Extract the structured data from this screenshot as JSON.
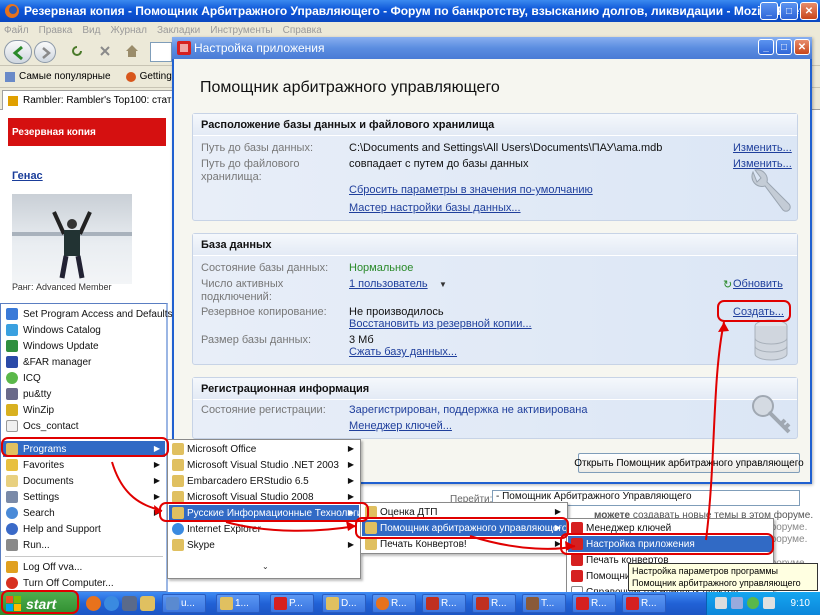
{
  "browser": {
    "title": "Резервная копия - Помощник Арбитражного Управляющего - Форум по банкротству, взысканию долгов, ликвидации - Mozilla Firefox",
    "menu": [
      "Файл",
      "Правка",
      "Вид",
      "Журнал",
      "Закладки",
      "Инструменты",
      "Справка"
    ],
    "bookmarks": [
      "Самые популярные",
      "Getting Starte"
    ],
    "tab": "Rambler: Rambler's Top100: статист..."
  },
  "web": {
    "header": "Резервная копия",
    "user": "Генас",
    "rank": "Ранг: Advanced Member"
  },
  "forum": {
    "goto_label": "Перейти:",
    "goto_value": "- Помощник Арбитражного Управляющего",
    "line1_bold": "можете",
    "line1": "создавать новые темы в этом форуме.",
    "frag1": "форуме.",
    "frag2": "форуме.",
    "frag3": "форуме."
  },
  "dialog": {
    "title": "Настройка приложения",
    "heading": "Помощник арбитражного управляющего",
    "storage": {
      "title": "Расположение базы данных и файлового хранилища",
      "db_path_label": "Путь до базы данных:",
      "db_path_value": "C:\\Documents and Settings\\All Users\\Documents\\ПАУ\\ama.mdb",
      "db_path_change": "Изменить...",
      "file_path_label": "Путь до файлового хранилища:",
      "file_path_value": "совпадает с путем до базы данных",
      "file_path_change": "Изменить...",
      "reset_link": "Сбросить параметры в значения по-умолчанию",
      "wizard_link": "Мастер настройки базы данных..."
    },
    "database": {
      "title": "База данных",
      "state_label": "Состояние базы данных:",
      "state_value": "Нормальное",
      "connections_label": "Число активных подключений:",
      "connections_value": "1 пользователь",
      "refresh": "Обновить",
      "backup_label": "Резервное копирование:",
      "backup_value": "Не производилось",
      "restore_link": "Восстановить из резервной копии...",
      "create_link": "Создать...",
      "size_label": "Размер базы данных:",
      "size_value": "3 Мб",
      "compress_link": "Сжать базу данных..."
    },
    "registration": {
      "title": "Регистрационная информация",
      "state_label": "Состояние регистрации:",
      "state_value": "Зарегистрирован, поддержка не активирована",
      "keys_link": "Менеджер ключей..."
    },
    "open_button": "Открыть Помощник арбитражного управляющего"
  },
  "start_menu": {
    "pinned": [
      "Set Program Access and Defaults",
      "Windows Catalog",
      "Windows Update",
      "&FAR manager",
      "ICQ",
      "pu&tty",
      "WinZip",
      "Ocs_contact"
    ],
    "items": [
      "Programs",
      "Favorites",
      "Documents",
      "Settings",
      "Search",
      "Help and Support",
      "Run..."
    ],
    "logoff": "Log Off vva...",
    "turnoff": "Turn Off Computer..."
  },
  "programs_menu": [
    "Microsoft Office",
    "Microsoft Visual Studio .NET 2003",
    "Embarcadero ERStudio 6.5",
    "Microsoft Visual Studio 2008",
    "Русские Информационные Технологии",
    "Internet Explorer",
    "Skype"
  ],
  "rit_menu": [
    "Оценка ДТП",
    "Помощник арбитражного управляющего",
    "Печать Конвертов!"
  ],
  "pau_menu": [
    "Менеджер ключей",
    "Настройка приложения",
    "Печать конвертов",
    "Помощник арбитражного управляющего",
    "Справочник населенных пунктов"
  ],
  "tooltip": "Настройка параметров программы Помощник арбитражного управляющего",
  "taskbar": {
    "start": "start",
    "items": [
      "u...",
      "1...",
      "P...",
      "D...",
      "R...",
      "R...",
      "R...",
      "T...",
      "R...",
      "R..."
    ],
    "clock": "9:10"
  },
  "colors": {
    "xp_blue": "#2161d6",
    "highlight": "#316ac5",
    "red_marker": "#e00000",
    "link": "#1f3f9c",
    "ok_green": "#2a8a2a"
  }
}
